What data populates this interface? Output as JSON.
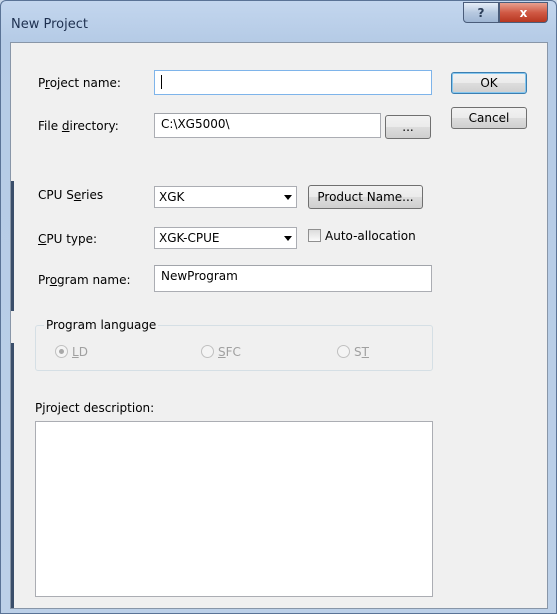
{
  "window": {
    "title": "New Project",
    "help_glyph": "?",
    "close_glyph": "x"
  },
  "form": {
    "project_name": {
      "label": "Project name:",
      "mnemonic": "r",
      "value": ""
    },
    "file_directory": {
      "label": "File directory:",
      "mnemonic": "d",
      "value": "C:\\XG5000\\",
      "browse_label": "..."
    },
    "cpu_series": {
      "label": "CPU Series",
      "mnemonic": "e",
      "selected": "XGK",
      "product_name_label": "Product Name..."
    },
    "cpu_type": {
      "label": "CPU type:",
      "mnemonic": "C",
      "selected": "XGK-CPUE",
      "auto_allocation_label": "Auto-allocation",
      "auto_allocation_checked": false
    },
    "program_name": {
      "label": "Program name:",
      "mnemonic": "o",
      "value": "NewProgram"
    },
    "program_language": {
      "legend": "Program language",
      "options": [
        {
          "label": "LD",
          "mnemonic": "L",
          "checked": true
        },
        {
          "label": "SFC",
          "mnemonic": "S",
          "checked": false
        },
        {
          "label": "ST",
          "mnemonic": "T",
          "checked": false
        }
      ]
    },
    "project_description": {
      "label": "Project description:",
      "mnemonic": "j",
      "value": ""
    }
  },
  "buttons": {
    "ok": "OK",
    "cancel": "Cancel"
  }
}
